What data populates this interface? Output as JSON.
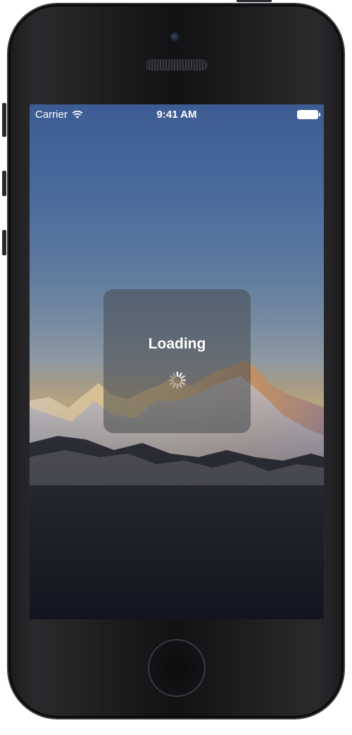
{
  "status_bar": {
    "carrier": "Carrier",
    "wifi_icon": "wifi-icon",
    "time": "9:41 AM",
    "battery_icon": "battery-icon"
  },
  "hud": {
    "title": "Loading",
    "spinner_icon": "activity-spinner-icon"
  },
  "device": {
    "home_button_icon": "home-button"
  }
}
